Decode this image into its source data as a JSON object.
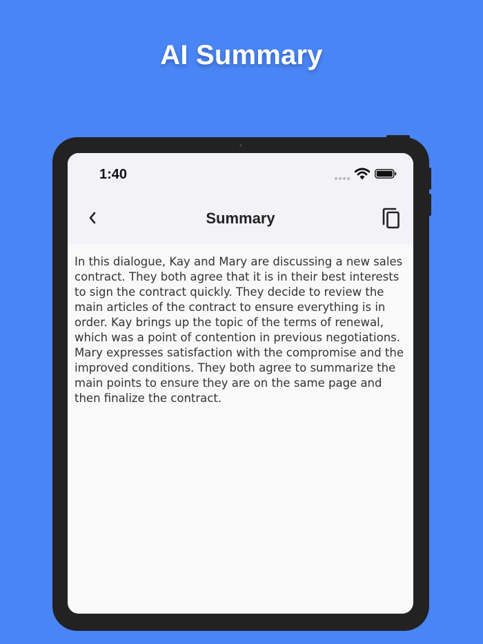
{
  "promo": {
    "title": "AI Summary"
  },
  "status_bar": {
    "time": "1:40"
  },
  "nav": {
    "title": "Summary",
    "back_icon": "chevron-left-icon",
    "copy_icon": "copy-icon"
  },
  "content": {
    "summary": "In this dialogue, Kay and Mary are discussing a new sales contract. They both agree that it is in their best interests to sign the contract quickly. They decide to review the main articles of the contract to ensure everything is in order. Kay brings up the topic of the terms of renewal, which was a point of contention in previous negotiations. Mary expresses satisfaction with the compromise and the improved conditions. They both agree to summarize the main points to ensure they are on the same page and then finalize the contract."
  },
  "colors": {
    "background": "#4a85f6",
    "device_frame": "#222222",
    "screen": "#f9f9f9",
    "nav_bar": "#f2f2f7"
  }
}
